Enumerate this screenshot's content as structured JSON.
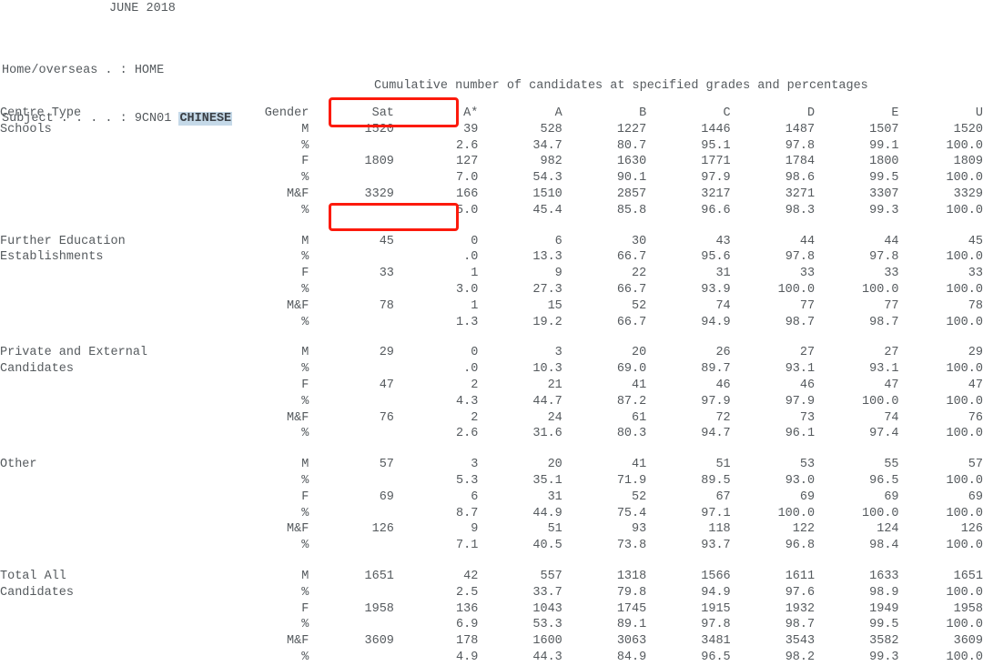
{
  "report": {
    "period": "JUNE 2018",
    "home_overseas_label": "Home/overseas . : ",
    "home_overseas_value": "HOME",
    "subject_label": "Subject . . . . : ",
    "subject_code": "9CN01 ",
    "subject_name": "CHINESE",
    "caption": "Cumulative number of candidates at specified grades and percentages"
  },
  "columns": {
    "centre_type": "Centre Type",
    "gender": "Gender",
    "sat": "Sat",
    "grades": [
      "A*",
      "A",
      "B",
      "C",
      "D",
      "E",
      "U"
    ]
  },
  "annotations": {
    "highlight_color": "#fc1a0c",
    "boxes": [
      {
        "name": "grade-header-highlight",
        "target": "A* and A column headers"
      },
      {
        "name": "schools-mf-percent-highlight",
        "target": "Schools M&F percentage row: 5.0 / 45.4"
      }
    ]
  },
  "table": {
    "pct_symbol": "%",
    "blocks": [
      {
        "name": "Schools",
        "label_lines": [
          "Schools",
          ""
        ],
        "rows": [
          {
            "gender": "M",
            "sat": "1520",
            "values": [
              "39",
              "528",
              "1227",
              "1446",
              "1487",
              "1507",
              "1520"
            ]
          },
          {
            "gender": "%",
            "sat": "",
            "values": [
              "2.6",
              "34.7",
              "80.7",
              "95.1",
              "97.8",
              "99.1",
              "100.0"
            ]
          },
          {
            "gender": "F",
            "sat": "1809",
            "values": [
              "127",
              "982",
              "1630",
              "1771",
              "1784",
              "1800",
              "1809"
            ]
          },
          {
            "gender": "%",
            "sat": "",
            "values": [
              "7.0",
              "54.3",
              "90.1",
              "97.9",
              "98.6",
              "99.5",
              "100.0"
            ]
          },
          {
            "gender": "M&F",
            "sat": "3329",
            "values": [
              "166",
              "1510",
              "2857",
              "3217",
              "3271",
              "3307",
              "3329"
            ]
          },
          {
            "gender": "%",
            "sat": "",
            "values": [
              "5.0",
              "45.4",
              "85.8",
              "96.6",
              "98.3",
              "99.3",
              "100.0"
            ]
          }
        ]
      },
      {
        "name": "Further Education Establishments",
        "label_lines": [
          "Further Education",
          "Establishments"
        ],
        "rows": [
          {
            "gender": "M",
            "sat": "45",
            "values": [
              "0",
              "6",
              "30",
              "43",
              "44",
              "44",
              "45"
            ]
          },
          {
            "gender": "%",
            "sat": "",
            "values": [
              ".0",
              "13.3",
              "66.7",
              "95.6",
              "97.8",
              "97.8",
              "100.0"
            ]
          },
          {
            "gender": "F",
            "sat": "33",
            "values": [
              "1",
              "9",
              "22",
              "31",
              "33",
              "33",
              "33"
            ]
          },
          {
            "gender": "%",
            "sat": "",
            "values": [
              "3.0",
              "27.3",
              "66.7",
              "93.9",
              "100.0",
              "100.0",
              "100.0"
            ]
          },
          {
            "gender": "M&F",
            "sat": "78",
            "values": [
              "1",
              "15",
              "52",
              "74",
              "77",
              "77",
              "78"
            ]
          },
          {
            "gender": "%",
            "sat": "",
            "values": [
              "1.3",
              "19.2",
              "66.7",
              "94.9",
              "98.7",
              "98.7",
              "100.0"
            ]
          }
        ]
      },
      {
        "name": "Private and External Candidates",
        "label_lines": [
          "Private and External",
          "Candidates"
        ],
        "rows": [
          {
            "gender": "M",
            "sat": "29",
            "values": [
              "0",
              "3",
              "20",
              "26",
              "27",
              "27",
              "29"
            ]
          },
          {
            "gender": "%",
            "sat": "",
            "values": [
              ".0",
              "10.3",
              "69.0",
              "89.7",
              "93.1",
              "93.1",
              "100.0"
            ]
          },
          {
            "gender": "F",
            "sat": "47",
            "values": [
              "2",
              "21",
              "41",
              "46",
              "46",
              "47",
              "47"
            ]
          },
          {
            "gender": "%",
            "sat": "",
            "values": [
              "4.3",
              "44.7",
              "87.2",
              "97.9",
              "97.9",
              "100.0",
              "100.0"
            ]
          },
          {
            "gender": "M&F",
            "sat": "76",
            "values": [
              "2",
              "24",
              "61",
              "72",
              "73",
              "74",
              "76"
            ]
          },
          {
            "gender": "%",
            "sat": "",
            "values": [
              "2.6",
              "31.6",
              "80.3",
              "94.7",
              "96.1",
              "97.4",
              "100.0"
            ]
          }
        ]
      },
      {
        "name": "Other",
        "label_lines": [
          "Other",
          ""
        ],
        "rows": [
          {
            "gender": "M",
            "sat": "57",
            "values": [
              "3",
              "20",
              "41",
              "51",
              "53",
              "55",
              "57"
            ]
          },
          {
            "gender": "%",
            "sat": "",
            "values": [
              "5.3",
              "35.1",
              "71.9",
              "89.5",
              "93.0",
              "96.5",
              "100.0"
            ]
          },
          {
            "gender": "F",
            "sat": "69",
            "values": [
              "6",
              "31",
              "52",
              "67",
              "69",
              "69",
              "69"
            ]
          },
          {
            "gender": "%",
            "sat": "",
            "values": [
              "8.7",
              "44.9",
              "75.4",
              "97.1",
              "100.0",
              "100.0",
              "100.0"
            ]
          },
          {
            "gender": "M&F",
            "sat": "126",
            "values": [
              "9",
              "51",
              "93",
              "118",
              "122",
              "124",
              "126"
            ]
          },
          {
            "gender": "%",
            "sat": "",
            "values": [
              "7.1",
              "40.5",
              "73.8",
              "93.7",
              "96.8",
              "98.4",
              "100.0"
            ]
          }
        ]
      },
      {
        "name": "Total All Candidates",
        "label_lines": [
          "Total All",
          "Candidates"
        ],
        "rows": [
          {
            "gender": "M",
            "sat": "1651",
            "values": [
              "42",
              "557",
              "1318",
              "1566",
              "1611",
              "1633",
              "1651"
            ]
          },
          {
            "gender": "%",
            "sat": "",
            "values": [
              "2.5",
              "33.7",
              "79.8",
              "94.9",
              "97.6",
              "98.9",
              "100.0"
            ]
          },
          {
            "gender": "F",
            "sat": "1958",
            "values": [
              "136",
              "1043",
              "1745",
              "1915",
              "1932",
              "1949",
              "1958"
            ]
          },
          {
            "gender": "%",
            "sat": "",
            "values": [
              "6.9",
              "53.3",
              "89.1",
              "97.8",
              "98.7",
              "99.5",
              "100.0"
            ]
          },
          {
            "gender": "M&F",
            "sat": "3609",
            "values": [
              "178",
              "1600",
              "3063",
              "3481",
              "3543",
              "3582",
              "3609"
            ]
          },
          {
            "gender": "%",
            "sat": "",
            "values": [
              "4.9",
              "44.3",
              "84.9",
              "96.5",
              "98.2",
              "99.3",
              "100.0"
            ]
          }
        ]
      }
    ]
  }
}
